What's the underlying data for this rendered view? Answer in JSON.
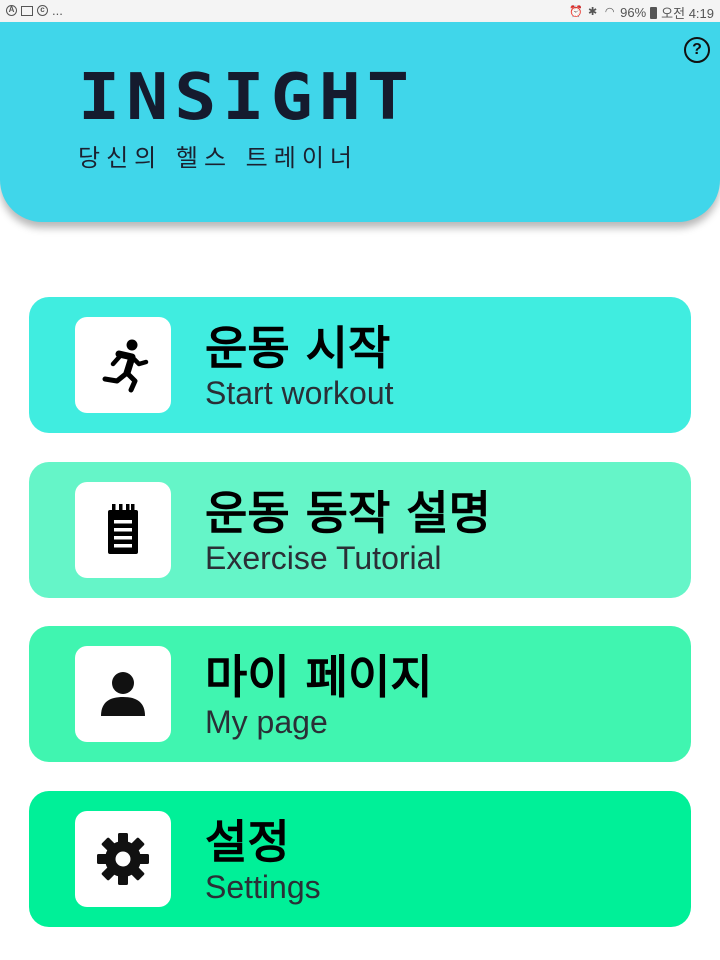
{
  "status_bar": {
    "left_icons": [
      "a-circle-icon",
      "image-icon",
      "sync-icon"
    ],
    "left_more": "...",
    "battery_percent": "96%",
    "time": "오전 4:19"
  },
  "header": {
    "title": "INSIGHT",
    "subtitle": "당신의 헬스 트레이너",
    "help_label": "?",
    "background": "#40d6ea"
  },
  "menu": [
    {
      "title": "운동 시작",
      "subtitle": "Start workout",
      "icon": "running-person-icon",
      "color": "#40ede0"
    },
    {
      "title": "운동 동작 설명",
      "subtitle": "Exercise Tutorial",
      "icon": "notepad-icon",
      "color": "#65f5c8"
    },
    {
      "title": "마이 페이지",
      "subtitle": "My page",
      "icon": "person-icon",
      "color": "#40f5b0"
    },
    {
      "title": "설정",
      "subtitle": "Settings",
      "icon": "gear-icon",
      "color": "#00f098"
    }
  ]
}
